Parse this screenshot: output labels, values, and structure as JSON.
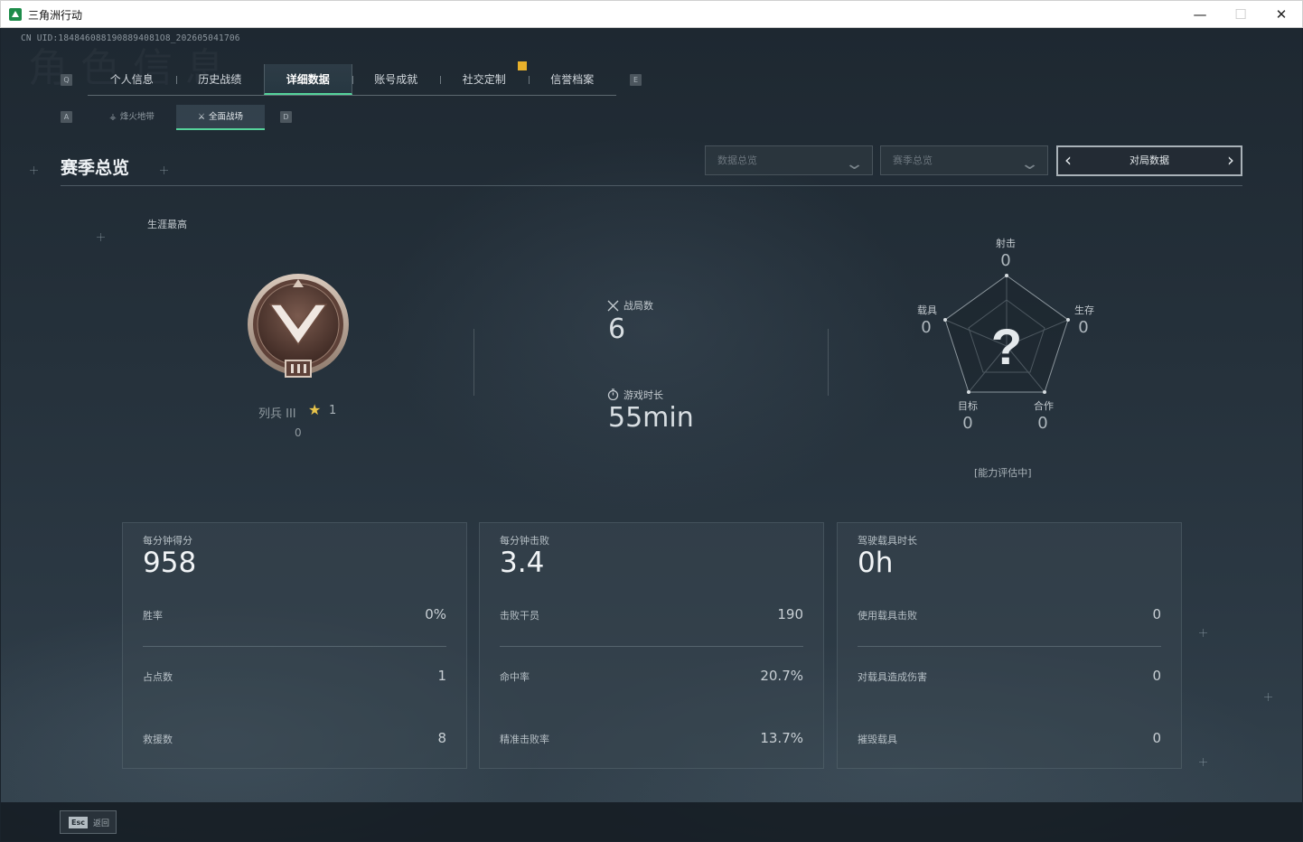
{
  "window": {
    "title": "三角洲行动",
    "minimize": "—",
    "maximize": "☐",
    "close": "✕"
  },
  "uid": "CN UID:1848460881908894081O8_202605041706",
  "watermark": "角色信息",
  "nav": {
    "prev_key": "Q",
    "next_key": "E",
    "tabs": [
      {
        "label": "个人信息",
        "active": false
      },
      {
        "label": "历史战绩",
        "active": false
      },
      {
        "label": "详细数据",
        "active": true
      },
      {
        "label": "账号成就",
        "active": false
      },
      {
        "label": "社交定制",
        "active": false
      },
      {
        "label": "信誉档案",
        "active": false
      }
    ],
    "sub_prev_key": "A",
    "sub_next_key": "D",
    "sub_tabs": [
      {
        "label": "烽火地带",
        "icon": "⚶",
        "active": false
      },
      {
        "label": "全面战场",
        "icon": "⚔",
        "active": true
      }
    ]
  },
  "header": {
    "title": "赛季总览",
    "dropdown_data": "数据总览",
    "dropdown_season": "赛季总览",
    "match_data": "对局数据"
  },
  "rank": {
    "career_label": "生涯最高",
    "name": "列兵 III",
    "stars": "1",
    "points": "0"
  },
  "summary": {
    "matches_label": "战局数",
    "matches_value": "6",
    "time_label": "游戏时长",
    "time_value": "55min"
  },
  "radar": {
    "center": "?",
    "status": "[能力评估中]",
    "axes": [
      {
        "label": "射击",
        "value": "0"
      },
      {
        "label": "生存",
        "value": "0"
      },
      {
        "label": "合作",
        "value": "0"
      },
      {
        "label": "目标",
        "value": "0"
      },
      {
        "label": "载具",
        "value": "0"
      }
    ]
  },
  "cards": [
    {
      "title": "每分钟得分",
      "value": "958",
      "rows": [
        {
          "label": "胜率",
          "value": "0%"
        },
        {
          "label": "占点数",
          "value": "1"
        },
        {
          "label": "救援数",
          "value": "8"
        }
      ]
    },
    {
      "title": "每分钟击败",
      "value": "3.4",
      "rows": [
        {
          "label": "击败干员",
          "value": "190"
        },
        {
          "label": "命中率",
          "value": "20.7%"
        },
        {
          "label": "精准击败率",
          "value": "13.7%"
        }
      ]
    },
    {
      "title": "驾驶载具时长",
      "value": "0h",
      "rows": [
        {
          "label": "使用载具击败",
          "value": "0"
        },
        {
          "label": "对载具造成伤害",
          "value": "0"
        },
        {
          "label": "摧毁载具",
          "value": "0"
        }
      ]
    }
  ],
  "footer": {
    "esc_key": "Esc",
    "back_label": "返回"
  }
}
